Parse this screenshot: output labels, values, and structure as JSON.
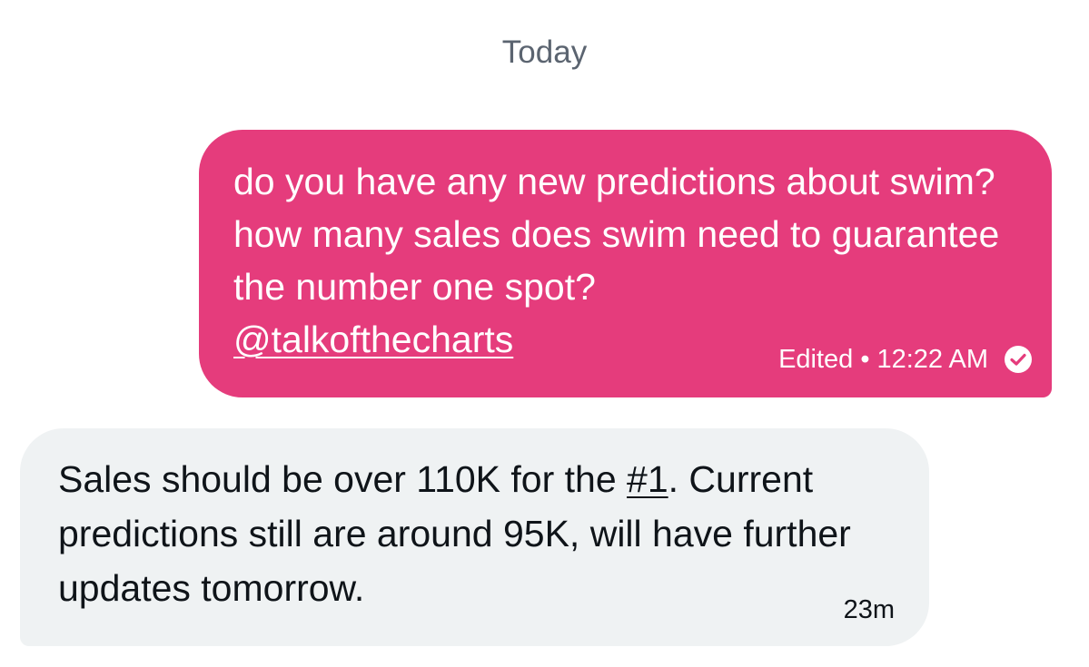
{
  "date_separator": "Today",
  "outgoing": {
    "text": "do you have any new predictions about swim? how many sales does swim need to guarantee the number one spot?",
    "mention": "@talkofthecharts",
    "edited_label": "Edited",
    "separator": "•",
    "timestamp": "12:22 AM",
    "status_icon": "sent-check-icon",
    "bubble_color": "#e53c7c"
  },
  "incoming": {
    "text_before": "Sales should be over 110K for the ",
    "hashtag": "#1",
    "text_after": ". Current predictions still are around 95K, will have further updates tomorrow.",
    "timestamp": "23m",
    "bubble_color": "#eff2f3"
  }
}
